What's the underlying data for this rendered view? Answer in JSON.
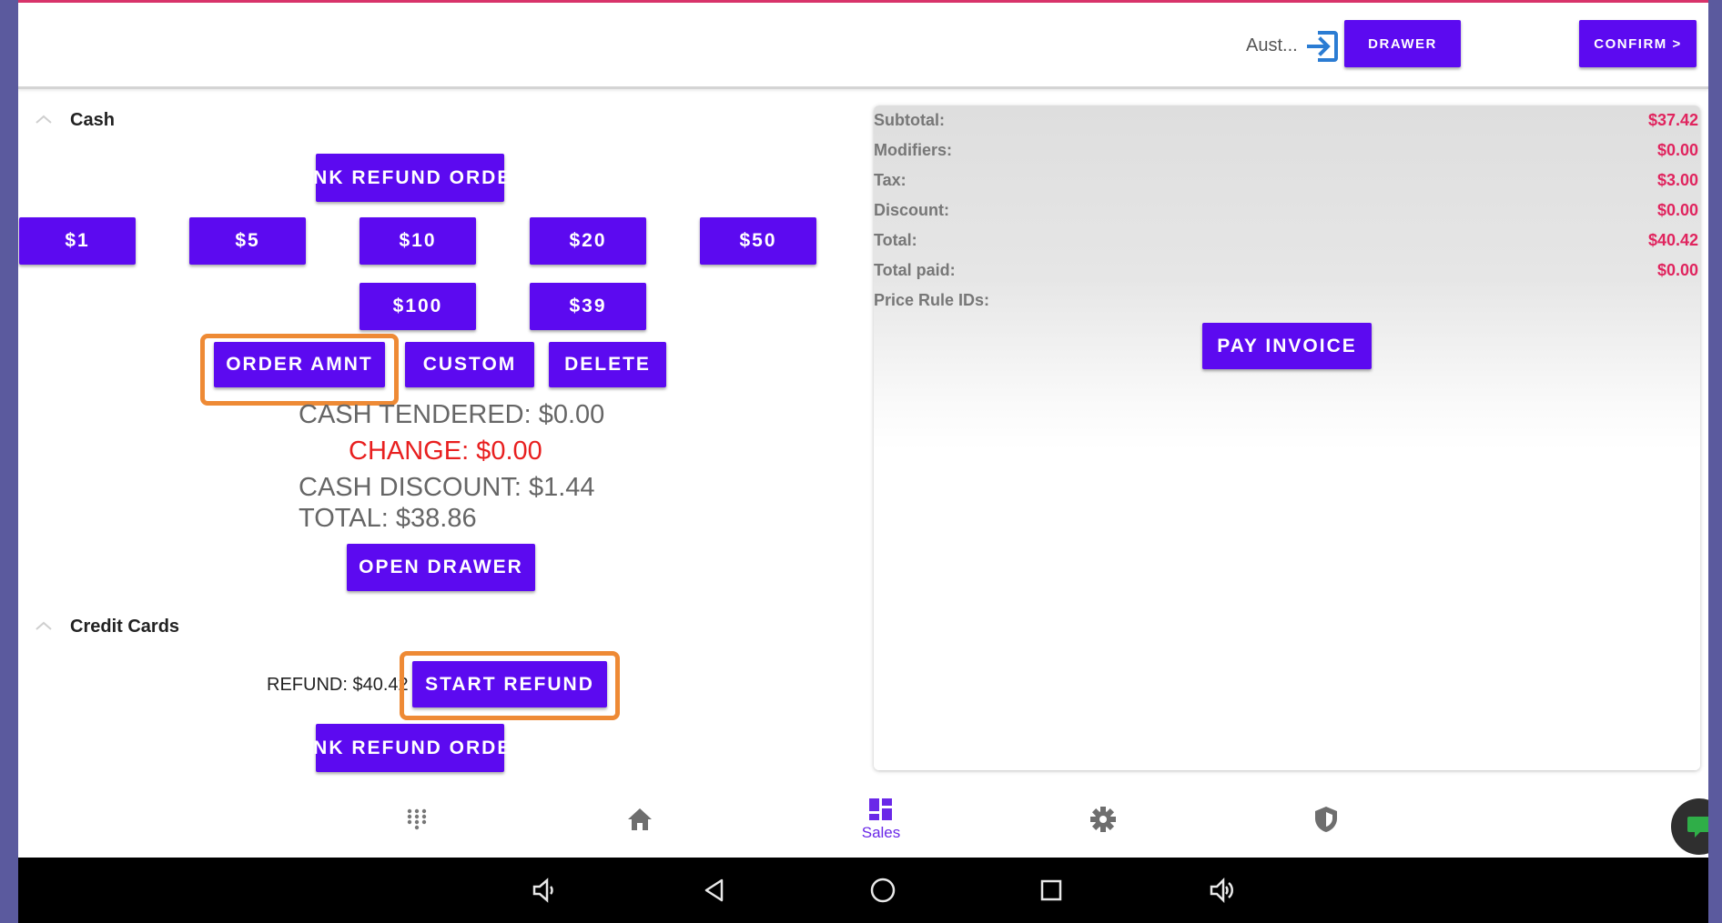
{
  "topbar": {
    "user_name": "Aust...",
    "drawer_label": "DRAWER",
    "confirm_label": "CONFIRM >"
  },
  "cash": {
    "title": "Cash",
    "link_refund_label": "LINK REFUND ORDER",
    "denominations": [
      "$1",
      "$5",
      "$10",
      "$20",
      "$50",
      "$100",
      "$39"
    ],
    "order_amount_label": "ORDER AMNT",
    "custom_label": "CUSTOM",
    "delete_label": "DELETE",
    "cash_tendered": "CASH TENDERED: $0.00",
    "change": "CHANGE: $0.00",
    "cash_discount": "CASH DISCOUNT: $1.44",
    "total": "TOTAL: $38.86",
    "open_drawer_label": "OPEN DRAWER"
  },
  "credit_cards": {
    "title": "Credit Cards",
    "refund_label": "REFUND: $40.42",
    "start_refund_label": "START REFUND",
    "link_refund_label": "LINK REFUND ORDER"
  },
  "summary": {
    "rows": [
      {
        "label": "Subtotal:",
        "value": "$37.42"
      },
      {
        "label": "Modifiers:",
        "value": "$0.00"
      },
      {
        "label": "Tax:",
        "value": "$3.00"
      },
      {
        "label": "Discount:",
        "value": "$0.00"
      },
      {
        "label": "Total:",
        "value": "$40.42"
      },
      {
        "label": "Total paid:",
        "value": "$0.00"
      },
      {
        "label": "Price Rule IDs:",
        "value": ""
      }
    ],
    "pay_invoice_label": "PAY INVOICE"
  },
  "bottom_nav": {
    "items": [
      {
        "icon": "apps-grid-icon",
        "label": ""
      },
      {
        "icon": "home-icon",
        "label": ""
      },
      {
        "icon": "dashboard-icon",
        "label": "Sales"
      },
      {
        "icon": "gear-icon",
        "label": ""
      },
      {
        "icon": "shield-icon",
        "label": ""
      }
    ],
    "active": "Sales"
  },
  "colors": {
    "primary": "#5c0af0",
    "highlight": "#ee8a35",
    "value_red": "#e0245e",
    "change_red": "#e81f1f",
    "frame": "#5b5a9e"
  }
}
